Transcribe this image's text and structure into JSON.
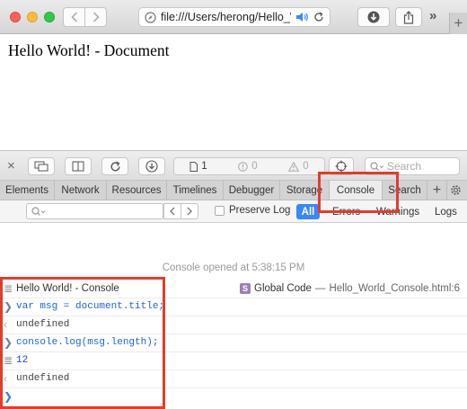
{
  "window": {
    "address": "file:///Users/herong/Hello_W",
    "colors": {
      "close": "#fc605c",
      "minimize": "#fdbc40",
      "zoom": "#34c84a"
    },
    "icons": [
      "back-arrow-icon",
      "forward-arrow-icon",
      "compass-icon",
      "speaker-icon",
      "reload-icon",
      "download-icon",
      "share-icon",
      "chevrons-icon",
      "plus-icon"
    ],
    "more_label": "»",
    "new_tab_label": "+"
  },
  "page": {
    "heading": "Hello World! - Document"
  },
  "inspector": {
    "toolbar": {
      "close_label": "×",
      "dashboard": {
        "resources_count": "1",
        "errors_count": "0",
        "warnings_count": "0"
      },
      "search_placeholder": "Search"
    },
    "tabs": [
      {
        "label": "Elements",
        "active": false
      },
      {
        "label": "Network",
        "active": false
      },
      {
        "label": "Resources",
        "active": false
      },
      {
        "label": "Timelines",
        "active": false
      },
      {
        "label": "Debugger",
        "active": false
      },
      {
        "label": "Storage",
        "active": false
      },
      {
        "label": "Console",
        "active": true
      },
      {
        "label": "Search",
        "active": false
      }
    ],
    "tab_add_label": "+",
    "filter": {
      "placeholder": "",
      "preserve_log_label": "Preserve Log",
      "levels": {
        "all": "All",
        "errors": "Errors",
        "warnings": "Warnings",
        "logs": "Logs"
      },
      "accent_color": "#3b87f6"
    },
    "console": {
      "opened_message": "Console opened at 5:38:15 PM",
      "entries": [
        {
          "kind": "log",
          "text": "Hello World! - Console"
        },
        {
          "kind": "input",
          "text": "var msg = document.title;"
        },
        {
          "kind": "output",
          "text": "undefined"
        },
        {
          "kind": "input",
          "text": "console.log(msg.length);"
        },
        {
          "kind": "log",
          "text": "12"
        },
        {
          "kind": "output",
          "text": "undefined"
        }
      ],
      "source": {
        "badge": "S",
        "label": "Global Code",
        "separator": "—",
        "file": "Hello_World_Console.html:6"
      }
    }
  },
  "annotations": {
    "highlight_color": "#e53b2c"
  }
}
